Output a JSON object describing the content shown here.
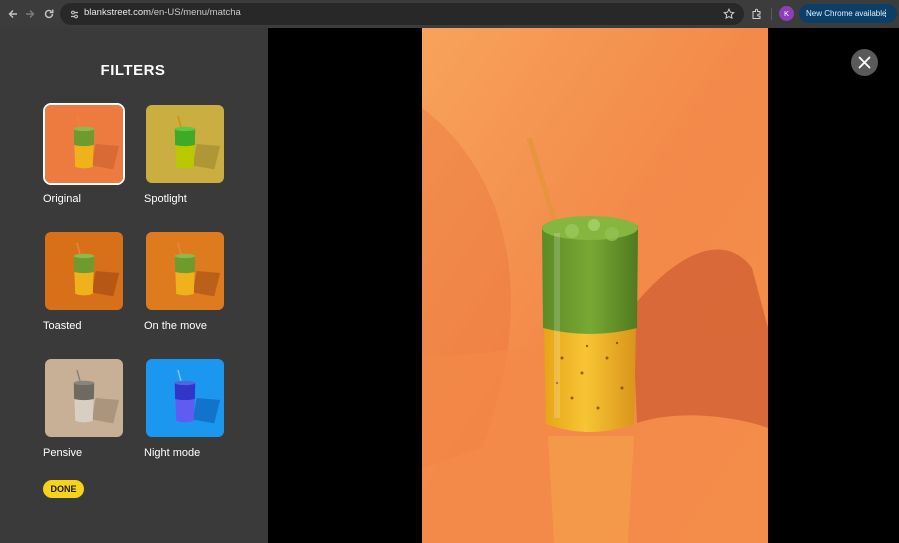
{
  "browser": {
    "url_host": "blankstreet.com",
    "url_path": "/en-US/menu/matcha",
    "profile_initial": "K",
    "update_button": "New Chrome available",
    "icons": [
      "back-arrow-icon",
      "forward-arrow-icon",
      "reload-icon",
      "site-settings-icon",
      "star-icon",
      "extensions-icon",
      "kebab-menu-icon"
    ]
  },
  "filters_panel": {
    "title": "FILTERS",
    "items": [
      {
        "label": "Original",
        "selected": true
      },
      {
        "label": "Spotlight",
        "selected": false
      },
      {
        "label": "Toasted",
        "selected": false
      },
      {
        "label": "On the move",
        "selected": false
      },
      {
        "label": "Pensive",
        "selected": false
      },
      {
        "label": "Night mode",
        "selected": false
      }
    ],
    "done_label": "DONE"
  },
  "viewer": {
    "close_icon": "close-icon"
  },
  "colors": {
    "panel_bg": "#3a3a3a",
    "accent_yellow": "#f6d31b",
    "photo_orange": "#f39447",
    "matcha_green": "#6e9a2e",
    "drink_yellow": "#f0b21c",
    "chrome_update_bg": "#0b3f67"
  }
}
